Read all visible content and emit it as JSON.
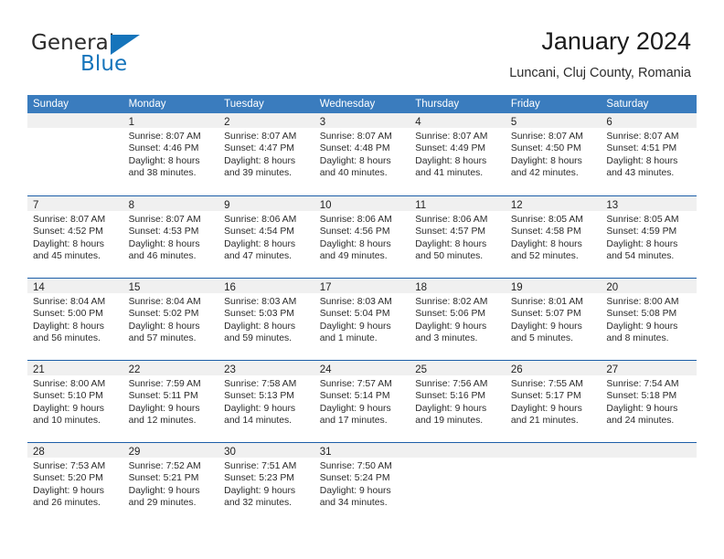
{
  "brand": {
    "word1": "General",
    "word2": "Blue",
    "accent_color": "#1574bb"
  },
  "header": {
    "title": "January 2024",
    "subtitle": "Luncani, Cluj County, Romania"
  },
  "calendar": {
    "header_color": "#3a7cbe",
    "grid_line_color": "#1c5ea8",
    "day_band_color": "#f0f0f0",
    "weekdays": [
      "Sunday",
      "Monday",
      "Tuesday",
      "Wednesday",
      "Thursday",
      "Friday",
      "Saturday"
    ],
    "weeks": [
      [
        {
          "day": "",
          "lines": []
        },
        {
          "day": "1",
          "lines": [
            "Sunrise: 8:07 AM",
            "Sunset: 4:46 PM",
            "Daylight: 8 hours",
            "and 38 minutes."
          ]
        },
        {
          "day": "2",
          "lines": [
            "Sunrise: 8:07 AM",
            "Sunset: 4:47 PM",
            "Daylight: 8 hours",
            "and 39 minutes."
          ]
        },
        {
          "day": "3",
          "lines": [
            "Sunrise: 8:07 AM",
            "Sunset: 4:48 PM",
            "Daylight: 8 hours",
            "and 40 minutes."
          ]
        },
        {
          "day": "4",
          "lines": [
            "Sunrise: 8:07 AM",
            "Sunset: 4:49 PM",
            "Daylight: 8 hours",
            "and 41 minutes."
          ]
        },
        {
          "day": "5",
          "lines": [
            "Sunrise: 8:07 AM",
            "Sunset: 4:50 PM",
            "Daylight: 8 hours",
            "and 42 minutes."
          ]
        },
        {
          "day": "6",
          "lines": [
            "Sunrise: 8:07 AM",
            "Sunset: 4:51 PM",
            "Daylight: 8 hours",
            "and 43 minutes."
          ]
        }
      ],
      [
        {
          "day": "7",
          "lines": [
            "Sunrise: 8:07 AM",
            "Sunset: 4:52 PM",
            "Daylight: 8 hours",
            "and 45 minutes."
          ]
        },
        {
          "day": "8",
          "lines": [
            "Sunrise: 8:07 AM",
            "Sunset: 4:53 PM",
            "Daylight: 8 hours",
            "and 46 minutes."
          ]
        },
        {
          "day": "9",
          "lines": [
            "Sunrise: 8:06 AM",
            "Sunset: 4:54 PM",
            "Daylight: 8 hours",
            "and 47 minutes."
          ]
        },
        {
          "day": "10",
          "lines": [
            "Sunrise: 8:06 AM",
            "Sunset: 4:56 PM",
            "Daylight: 8 hours",
            "and 49 minutes."
          ]
        },
        {
          "day": "11",
          "lines": [
            "Sunrise: 8:06 AM",
            "Sunset: 4:57 PM",
            "Daylight: 8 hours",
            "and 50 minutes."
          ]
        },
        {
          "day": "12",
          "lines": [
            "Sunrise: 8:05 AM",
            "Sunset: 4:58 PM",
            "Daylight: 8 hours",
            "and 52 minutes."
          ]
        },
        {
          "day": "13",
          "lines": [
            "Sunrise: 8:05 AM",
            "Sunset: 4:59 PM",
            "Daylight: 8 hours",
            "and 54 minutes."
          ]
        }
      ],
      [
        {
          "day": "14",
          "lines": [
            "Sunrise: 8:04 AM",
            "Sunset: 5:00 PM",
            "Daylight: 8 hours",
            "and 56 minutes."
          ]
        },
        {
          "day": "15",
          "lines": [
            "Sunrise: 8:04 AM",
            "Sunset: 5:02 PM",
            "Daylight: 8 hours",
            "and 57 minutes."
          ]
        },
        {
          "day": "16",
          "lines": [
            "Sunrise: 8:03 AM",
            "Sunset: 5:03 PM",
            "Daylight: 8 hours",
            "and 59 minutes."
          ]
        },
        {
          "day": "17",
          "lines": [
            "Sunrise: 8:03 AM",
            "Sunset: 5:04 PM",
            "Daylight: 9 hours",
            "and 1 minute."
          ]
        },
        {
          "day": "18",
          "lines": [
            "Sunrise: 8:02 AM",
            "Sunset: 5:06 PM",
            "Daylight: 9 hours",
            "and 3 minutes."
          ]
        },
        {
          "day": "19",
          "lines": [
            "Sunrise: 8:01 AM",
            "Sunset: 5:07 PM",
            "Daylight: 9 hours",
            "and 5 minutes."
          ]
        },
        {
          "day": "20",
          "lines": [
            "Sunrise: 8:00 AM",
            "Sunset: 5:08 PM",
            "Daylight: 9 hours",
            "and 8 minutes."
          ]
        }
      ],
      [
        {
          "day": "21",
          "lines": [
            "Sunrise: 8:00 AM",
            "Sunset: 5:10 PM",
            "Daylight: 9 hours",
            "and 10 minutes."
          ]
        },
        {
          "day": "22",
          "lines": [
            "Sunrise: 7:59 AM",
            "Sunset: 5:11 PM",
            "Daylight: 9 hours",
            "and 12 minutes."
          ]
        },
        {
          "day": "23",
          "lines": [
            "Sunrise: 7:58 AM",
            "Sunset: 5:13 PM",
            "Daylight: 9 hours",
            "and 14 minutes."
          ]
        },
        {
          "day": "24",
          "lines": [
            "Sunrise: 7:57 AM",
            "Sunset: 5:14 PM",
            "Daylight: 9 hours",
            "and 17 minutes."
          ]
        },
        {
          "day": "25",
          "lines": [
            "Sunrise: 7:56 AM",
            "Sunset: 5:16 PM",
            "Daylight: 9 hours",
            "and 19 minutes."
          ]
        },
        {
          "day": "26",
          "lines": [
            "Sunrise: 7:55 AM",
            "Sunset: 5:17 PM",
            "Daylight: 9 hours",
            "and 21 minutes."
          ]
        },
        {
          "day": "27",
          "lines": [
            "Sunrise: 7:54 AM",
            "Sunset: 5:18 PM",
            "Daylight: 9 hours",
            "and 24 minutes."
          ]
        }
      ],
      [
        {
          "day": "28",
          "lines": [
            "Sunrise: 7:53 AM",
            "Sunset: 5:20 PM",
            "Daylight: 9 hours",
            "and 26 minutes."
          ]
        },
        {
          "day": "29",
          "lines": [
            "Sunrise: 7:52 AM",
            "Sunset: 5:21 PM",
            "Daylight: 9 hours",
            "and 29 minutes."
          ]
        },
        {
          "day": "30",
          "lines": [
            "Sunrise: 7:51 AM",
            "Sunset: 5:23 PM",
            "Daylight: 9 hours",
            "and 32 minutes."
          ]
        },
        {
          "day": "31",
          "lines": [
            "Sunrise: 7:50 AM",
            "Sunset: 5:24 PM",
            "Daylight: 9 hours",
            "and 34 minutes."
          ]
        },
        {
          "day": "",
          "lines": []
        },
        {
          "day": "",
          "lines": []
        },
        {
          "day": "",
          "lines": []
        }
      ]
    ]
  }
}
